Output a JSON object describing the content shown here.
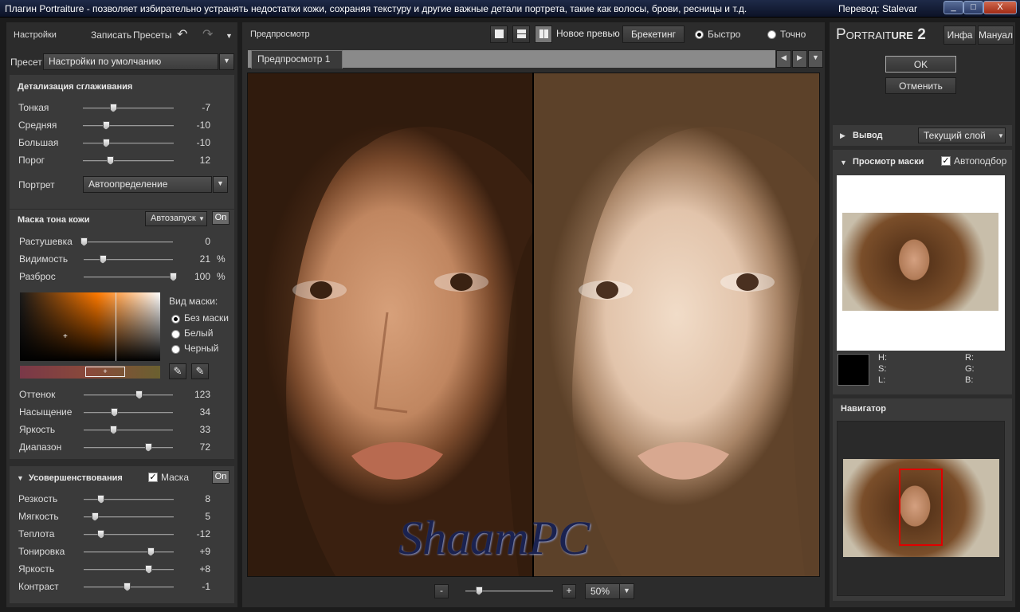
{
  "titlebar": {
    "title": "Плагин Portraiture - позволяет избирательно устранять недостатки кожи, сохраняя текстуру и другие важные детали портрета, такие как волосы, брови, ресницы и т.д.",
    "translator": "Перевод: Stalevar",
    "min": "_",
    "max": "□",
    "close": "X"
  },
  "left": {
    "toolbar": {
      "settings": "Настройки",
      "save": "Записать",
      "presets": "Пресеты"
    },
    "preset": {
      "label": "Пресет",
      "value": "Настройки по умолчанию"
    },
    "detail": {
      "title": "Детализация сглаживания",
      "sliders": [
        {
          "label": "Тонкая",
          "value": "-7",
          "pos": 0.33
        },
        {
          "label": "Средняя",
          "value": "-10",
          "pos": 0.25
        },
        {
          "label": "Большая",
          "value": "-10",
          "pos": 0.25
        },
        {
          "label": "Порог",
          "value": "12",
          "pos": 0.3
        }
      ],
      "portrait_label": "Портрет",
      "portrait_value": "Автоопределение"
    },
    "skin": {
      "title": "Маска тона кожи",
      "mode": "Автозапуск",
      "on": "On",
      "sliders": [
        {
          "label": "Растушевка",
          "value": "0",
          "unit": "",
          "pos": 0.0
        },
        {
          "label": "Видимость",
          "value": "21",
          "unit": "%",
          "pos": 0.21
        },
        {
          "label": "Разброс",
          "value": "100",
          "unit": "%",
          "pos": 1.0
        }
      ],
      "mask_view_title": "Вид маски:",
      "mask_options": [
        "Без маски",
        "Белый",
        "Черный"
      ],
      "hsl": [
        {
          "label": "Оттенок",
          "value": "123",
          "pos": 0.62
        },
        {
          "label": "Насыщение",
          "value": "34",
          "pos": 0.34
        },
        {
          "label": "Яркость",
          "value": "33",
          "pos": 0.33
        },
        {
          "label": "Диапазон",
          "value": "72",
          "pos": 0.72
        }
      ]
    },
    "enh": {
      "title": "Усовершенствования",
      "mask_label": "Маска",
      "on": "On",
      "sliders": [
        {
          "label": "Резкость",
          "value": "8",
          "pos": 0.19
        },
        {
          "label": "Мягкость",
          "value": "5",
          "pos": 0.12
        },
        {
          "label": "Теплота",
          "value": "-12",
          "pos": 0.19
        },
        {
          "label": "Тонировка",
          "value": "+9",
          "pos": 0.74
        },
        {
          "label": "Яркость",
          "value": "+8",
          "pos": 0.72
        },
        {
          "label": "Контраст",
          "value": "-1",
          "pos": 0.48
        }
      ]
    }
  },
  "center": {
    "title": "Предпросмотр",
    "new_preview": "Новое превью",
    "bracketing": "Брекетинг",
    "fast": "Быстро",
    "precise": "Точно",
    "tab": "Предпросмотр 1",
    "zoom": "50%",
    "zoom_pos": 0.15,
    "minus": "-",
    "plus": "+",
    "watermark": "ShaamPC"
  },
  "right": {
    "logo_a": "Portrait",
    "logo_b": "ure 2",
    "info": "Инфа",
    "manual": "Мануал",
    "ok": "OK",
    "cancel": "Отменить",
    "output_label": "Вывод",
    "output_value": "Текущий слой",
    "mask_preview": "Просмотр маски",
    "auto": "Автоподбор",
    "color": {
      "h": "H:",
      "s": "S:",
      "l": "L:",
      "r": "R:",
      "g": "G:",
      "b": "B:"
    },
    "navigator": "Навигатор"
  }
}
